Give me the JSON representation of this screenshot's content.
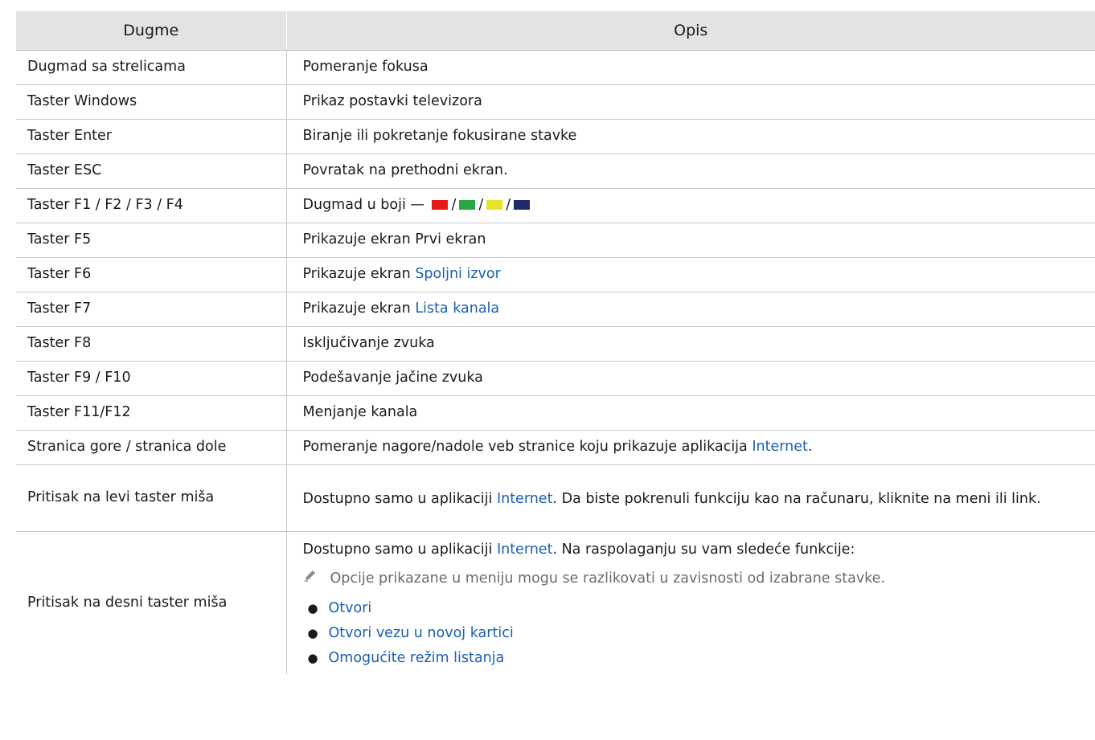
{
  "header": {
    "col1": "Dugme",
    "col2": "Opis"
  },
  "rows": [
    {
      "key": "Dugmad sa strelicama",
      "desc": "Pomeranje fokusa"
    },
    {
      "key": "Taster Windows",
      "desc": "Prikaz postavki televizora"
    },
    {
      "key": "Taster Enter",
      "desc": "Biranje ili pokretanje fokusirane stavke"
    },
    {
      "key": "Taster ESC",
      "desc": "Povratak na prethodni ekran."
    },
    {
      "key": "Taster F1 / F2 / F3 / F4",
      "desc_prefix": "Dugmad u boji —",
      "sep": "/",
      "colors": [
        "#e41b1b",
        "#27a844",
        "#e8e22a",
        "#1d2a6b"
      ]
    },
    {
      "key": "Taster F5",
      "desc": "Prikazuje ekran Prvi ekran"
    },
    {
      "key": "Taster F6",
      "desc_prefix": "Prikazuje ekran",
      "desc_link": "Spoljni izvor"
    },
    {
      "key": "Taster F7",
      "desc_prefix": "Prikazuje ekran",
      "desc_link": "Lista kanala"
    },
    {
      "key": "Taster F8",
      "desc": "Isključivanje zvuka"
    },
    {
      "key": "Taster F9 / F10",
      "desc": "Podešavanje jačine zvuka"
    },
    {
      "key": "Taster F11/F12",
      "desc": "Menjanje kanala"
    },
    {
      "key": "Stranica gore / stranica dole",
      "desc_prefix": "Pomeranje nagore/nadole veb stranice koju prikazuje aplikacija",
      "desc_link": "Internet",
      "desc_suffix": "."
    },
    {
      "key": "Pritisak na levi taster miša",
      "desc_prefix": "Dostupno samo u aplikaciji",
      "desc_link": "Internet",
      "desc_suffix": ". Da biste pokrenuli funkciju kao na računaru, kliknite na meni ili link."
    },
    {
      "key": "Pritisak na desni taster miša",
      "desc_prefix": "Dostupno samo u aplikaciji",
      "desc_link": "Internet",
      "desc_suffix": ". Na raspolaganju su vam sledeće funkcije:",
      "note": "Opcije prikazane u meniju mogu se razlikovati u zavisnosti od izabrane stavke.",
      "note_icon": "pencil-icon",
      "bullets": [
        "Otvori",
        "Otvori vezu u novoj kartici",
        "Omogućite režim listanja"
      ]
    }
  ]
}
